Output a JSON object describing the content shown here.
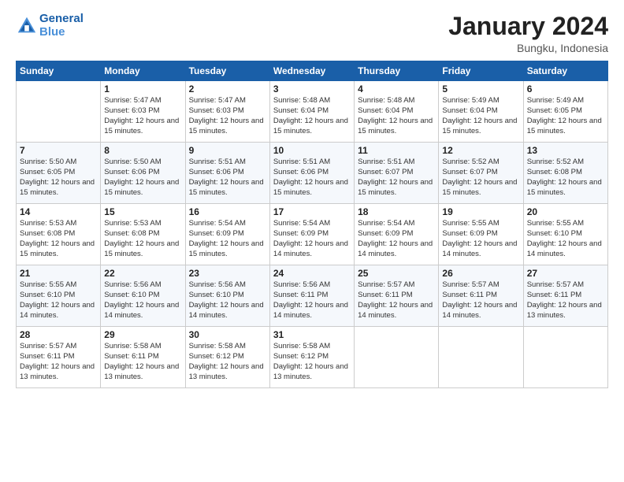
{
  "header": {
    "logo_line1": "General",
    "logo_line2": "Blue",
    "month": "January 2024",
    "location": "Bungku, Indonesia"
  },
  "weekdays": [
    "Sunday",
    "Monday",
    "Tuesday",
    "Wednesday",
    "Thursday",
    "Friday",
    "Saturday"
  ],
  "weeks": [
    [
      {
        "day": "",
        "sunrise": "",
        "sunset": "",
        "daylight": ""
      },
      {
        "day": "1",
        "sunrise": "Sunrise: 5:47 AM",
        "sunset": "Sunset: 6:03 PM",
        "daylight": "Daylight: 12 hours and 15 minutes."
      },
      {
        "day": "2",
        "sunrise": "Sunrise: 5:47 AM",
        "sunset": "Sunset: 6:03 PM",
        "daylight": "Daylight: 12 hours and 15 minutes."
      },
      {
        "day": "3",
        "sunrise": "Sunrise: 5:48 AM",
        "sunset": "Sunset: 6:04 PM",
        "daylight": "Daylight: 12 hours and 15 minutes."
      },
      {
        "day": "4",
        "sunrise": "Sunrise: 5:48 AM",
        "sunset": "Sunset: 6:04 PM",
        "daylight": "Daylight: 12 hours and 15 minutes."
      },
      {
        "day": "5",
        "sunrise": "Sunrise: 5:49 AM",
        "sunset": "Sunset: 6:04 PM",
        "daylight": "Daylight: 12 hours and 15 minutes."
      },
      {
        "day": "6",
        "sunrise": "Sunrise: 5:49 AM",
        "sunset": "Sunset: 6:05 PM",
        "daylight": "Daylight: 12 hours and 15 minutes."
      }
    ],
    [
      {
        "day": "7",
        "sunrise": "Sunrise: 5:50 AM",
        "sunset": "Sunset: 6:05 PM",
        "daylight": "Daylight: 12 hours and 15 minutes."
      },
      {
        "day": "8",
        "sunrise": "Sunrise: 5:50 AM",
        "sunset": "Sunset: 6:06 PM",
        "daylight": "Daylight: 12 hours and 15 minutes."
      },
      {
        "day": "9",
        "sunrise": "Sunrise: 5:51 AM",
        "sunset": "Sunset: 6:06 PM",
        "daylight": "Daylight: 12 hours and 15 minutes."
      },
      {
        "day": "10",
        "sunrise": "Sunrise: 5:51 AM",
        "sunset": "Sunset: 6:06 PM",
        "daylight": "Daylight: 12 hours and 15 minutes."
      },
      {
        "day": "11",
        "sunrise": "Sunrise: 5:51 AM",
        "sunset": "Sunset: 6:07 PM",
        "daylight": "Daylight: 12 hours and 15 minutes."
      },
      {
        "day": "12",
        "sunrise": "Sunrise: 5:52 AM",
        "sunset": "Sunset: 6:07 PM",
        "daylight": "Daylight: 12 hours and 15 minutes."
      },
      {
        "day": "13",
        "sunrise": "Sunrise: 5:52 AM",
        "sunset": "Sunset: 6:08 PM",
        "daylight": "Daylight: 12 hours and 15 minutes."
      }
    ],
    [
      {
        "day": "14",
        "sunrise": "Sunrise: 5:53 AM",
        "sunset": "Sunset: 6:08 PM",
        "daylight": "Daylight: 12 hours and 15 minutes."
      },
      {
        "day": "15",
        "sunrise": "Sunrise: 5:53 AM",
        "sunset": "Sunset: 6:08 PM",
        "daylight": "Daylight: 12 hours and 15 minutes."
      },
      {
        "day": "16",
        "sunrise": "Sunrise: 5:54 AM",
        "sunset": "Sunset: 6:09 PM",
        "daylight": "Daylight: 12 hours and 15 minutes."
      },
      {
        "day": "17",
        "sunrise": "Sunrise: 5:54 AM",
        "sunset": "Sunset: 6:09 PM",
        "daylight": "Daylight: 12 hours and 14 minutes."
      },
      {
        "day": "18",
        "sunrise": "Sunrise: 5:54 AM",
        "sunset": "Sunset: 6:09 PM",
        "daylight": "Daylight: 12 hours and 14 minutes."
      },
      {
        "day": "19",
        "sunrise": "Sunrise: 5:55 AM",
        "sunset": "Sunset: 6:09 PM",
        "daylight": "Daylight: 12 hours and 14 minutes."
      },
      {
        "day": "20",
        "sunrise": "Sunrise: 5:55 AM",
        "sunset": "Sunset: 6:10 PM",
        "daylight": "Daylight: 12 hours and 14 minutes."
      }
    ],
    [
      {
        "day": "21",
        "sunrise": "Sunrise: 5:55 AM",
        "sunset": "Sunset: 6:10 PM",
        "daylight": "Daylight: 12 hours and 14 minutes."
      },
      {
        "day": "22",
        "sunrise": "Sunrise: 5:56 AM",
        "sunset": "Sunset: 6:10 PM",
        "daylight": "Daylight: 12 hours and 14 minutes."
      },
      {
        "day": "23",
        "sunrise": "Sunrise: 5:56 AM",
        "sunset": "Sunset: 6:10 PM",
        "daylight": "Daylight: 12 hours and 14 minutes."
      },
      {
        "day": "24",
        "sunrise": "Sunrise: 5:56 AM",
        "sunset": "Sunset: 6:11 PM",
        "daylight": "Daylight: 12 hours and 14 minutes."
      },
      {
        "day": "25",
        "sunrise": "Sunrise: 5:57 AM",
        "sunset": "Sunset: 6:11 PM",
        "daylight": "Daylight: 12 hours and 14 minutes."
      },
      {
        "day": "26",
        "sunrise": "Sunrise: 5:57 AM",
        "sunset": "Sunset: 6:11 PM",
        "daylight": "Daylight: 12 hours and 14 minutes."
      },
      {
        "day": "27",
        "sunrise": "Sunrise: 5:57 AM",
        "sunset": "Sunset: 6:11 PM",
        "daylight": "Daylight: 12 hours and 13 minutes."
      }
    ],
    [
      {
        "day": "28",
        "sunrise": "Sunrise: 5:57 AM",
        "sunset": "Sunset: 6:11 PM",
        "daylight": "Daylight: 12 hours and 13 minutes."
      },
      {
        "day": "29",
        "sunrise": "Sunrise: 5:58 AM",
        "sunset": "Sunset: 6:11 PM",
        "daylight": "Daylight: 12 hours and 13 minutes."
      },
      {
        "day": "30",
        "sunrise": "Sunrise: 5:58 AM",
        "sunset": "Sunset: 6:12 PM",
        "daylight": "Daylight: 12 hours and 13 minutes."
      },
      {
        "day": "31",
        "sunrise": "Sunrise: 5:58 AM",
        "sunset": "Sunset: 6:12 PM",
        "daylight": "Daylight: 12 hours and 13 minutes."
      },
      {
        "day": "",
        "sunrise": "",
        "sunset": "",
        "daylight": ""
      },
      {
        "day": "",
        "sunrise": "",
        "sunset": "",
        "daylight": ""
      },
      {
        "day": "",
        "sunrise": "",
        "sunset": "",
        "daylight": ""
      }
    ]
  ]
}
